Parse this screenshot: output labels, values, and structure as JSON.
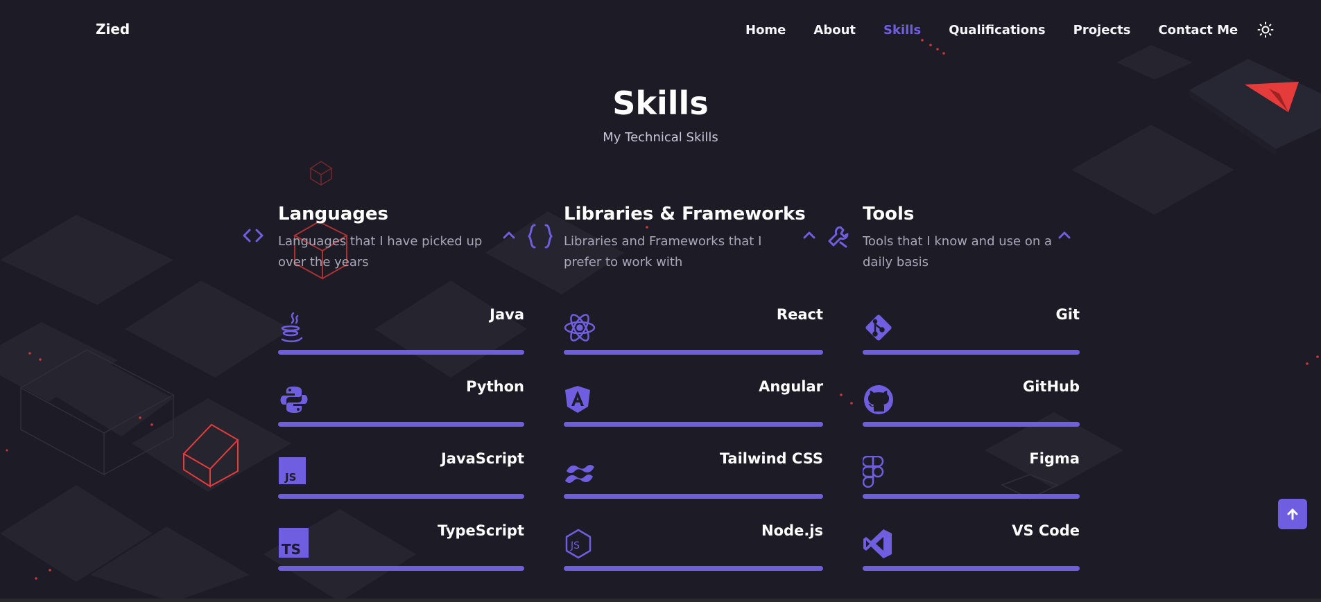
{
  "header": {
    "logo": "Zied",
    "nav": [
      {
        "label": "Home",
        "active": false
      },
      {
        "label": "About",
        "active": false
      },
      {
        "label": "Skills",
        "active": true
      },
      {
        "label": "Qualifications",
        "active": false
      },
      {
        "label": "Projects",
        "active": false
      },
      {
        "label": "Contact Me",
        "active": false
      }
    ],
    "theme_icon": "sun-icon"
  },
  "section": {
    "title": "Skills",
    "subtitle": "My Technical Skills"
  },
  "columns": [
    {
      "icon": "code-brackets-icon",
      "title": "Languages",
      "description": "Languages that I have picked up over the years",
      "skills": [
        {
          "name": "Java",
          "icon": "java-icon",
          "level": 1.0
        },
        {
          "name": "Python",
          "icon": "python-icon",
          "level": 1.0
        },
        {
          "name": "JavaScript",
          "icon": "javascript-icon",
          "level": 1.0
        },
        {
          "name": "TypeScript",
          "icon": "typescript-icon",
          "level": 1.0
        }
      ]
    },
    {
      "icon": "curly-braces-icon",
      "title": "Libraries & Frameworks",
      "description": "Libraries and Frameworks that I prefer to work with",
      "skills": [
        {
          "name": "React",
          "icon": "react-icon",
          "level": 1.0
        },
        {
          "name": "Angular",
          "icon": "angular-icon",
          "level": 1.0
        },
        {
          "name": "Tailwind CSS",
          "icon": "tailwind-icon",
          "level": 1.0
        },
        {
          "name": "Node.js",
          "icon": "nodejs-icon",
          "level": 1.0
        }
      ]
    },
    {
      "icon": "tools-icon",
      "title": "Tools",
      "description": "Tools that I know and use on a daily basis",
      "skills": [
        {
          "name": "Git",
          "icon": "git-icon",
          "level": 1.0
        },
        {
          "name": "GitHub",
          "icon": "github-icon",
          "level": 1.0
        },
        {
          "name": "Figma",
          "icon": "figma-icon",
          "level": 1.0
        },
        {
          "name": "VS Code",
          "icon": "vscode-icon",
          "level": 1.0
        }
      ]
    }
  ],
  "colors": {
    "background": "#1d1c26",
    "accent": "#6f5ee0",
    "text": "#ffffff",
    "muted": "#a9a7b8",
    "decor_red": "#e53b3b"
  },
  "scroll_top_icon": "arrow-up-icon"
}
